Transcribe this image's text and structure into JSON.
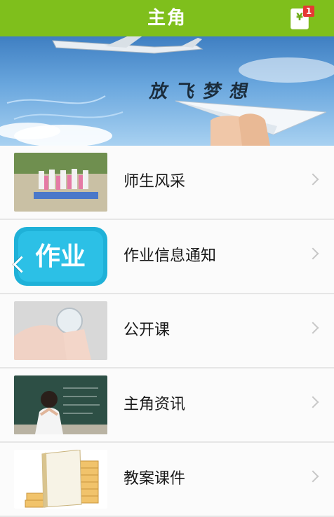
{
  "header": {
    "title": "主角",
    "wallet_badge": "1",
    "wallet_symbol": "¥"
  },
  "banner": {
    "caption": "放飞梦想"
  },
  "menu": [
    {
      "label": "师生风采",
      "thumb_icon": "students-photo"
    },
    {
      "label": "作业信息通知",
      "thumb_icon": "homework-icon",
      "thumb_text": "作业"
    },
    {
      "label": "公开课",
      "thumb_icon": "open-class-photo"
    },
    {
      "label": "主角资讯",
      "thumb_icon": "news-photo"
    },
    {
      "label": "教案课件",
      "thumb_icon": "books-photo"
    }
  ],
  "colors": {
    "brand_green": "#7fbf1c",
    "homework_blue": "#1fb1d8"
  }
}
